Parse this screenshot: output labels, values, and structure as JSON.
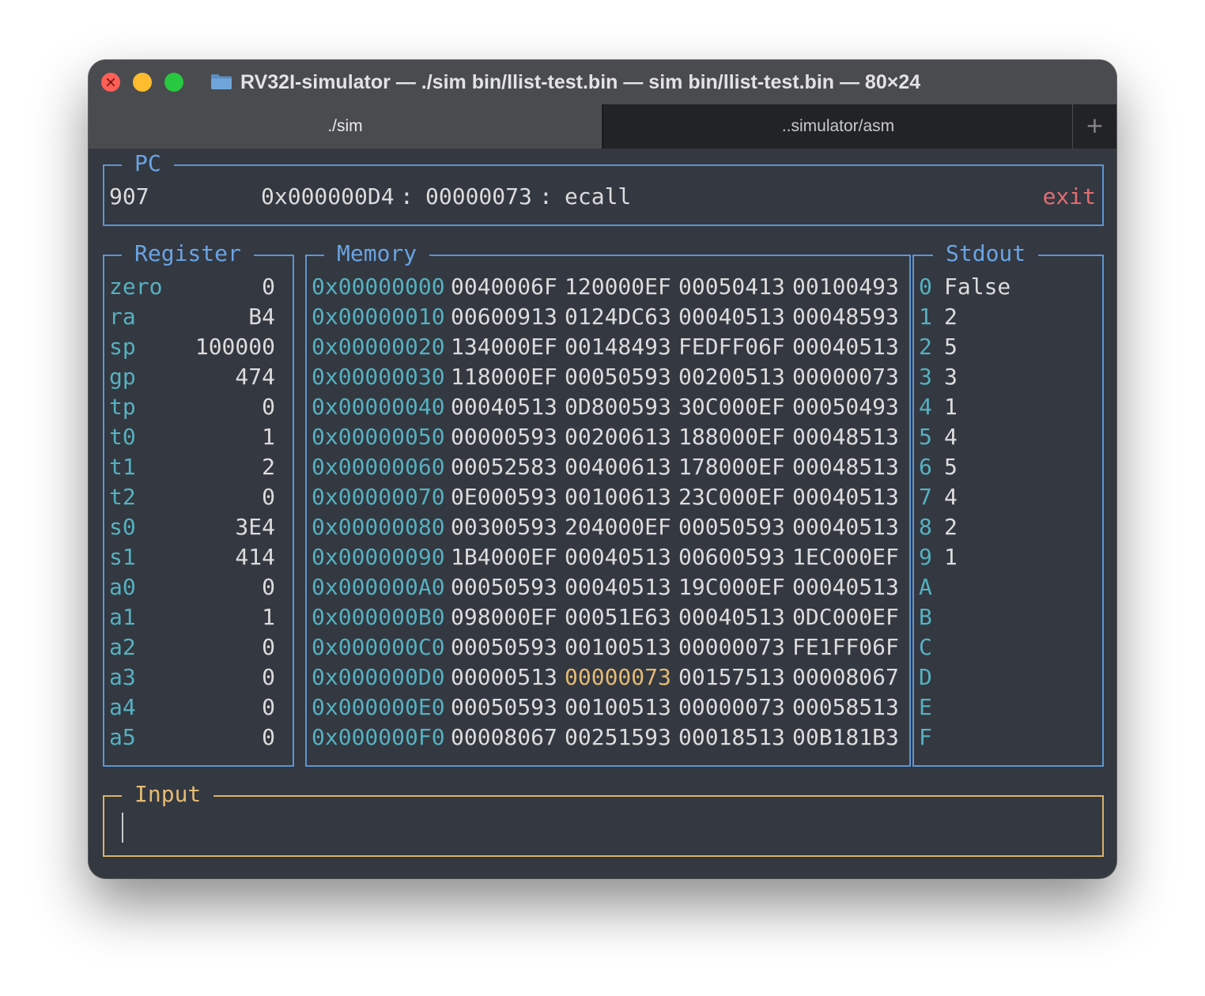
{
  "window": {
    "title": "RV32I-simulator — ./sim bin/llist-test.bin — sim bin/llist-test.bin — 80×24",
    "folder_icon": "folder-icon",
    "buttons": {
      "close": "close-icon",
      "minimize": "minimize-icon",
      "zoom": "zoom-icon"
    }
  },
  "tabs": [
    {
      "label": "./sim",
      "active": true
    },
    {
      "label": "..simulator/asm",
      "active": false
    }
  ],
  "new_tab_symbol": "+",
  "pc_panel": {
    "title": "PC",
    "count": "907",
    "address": "0x000000D4",
    "sep1": ":",
    "instruction_hex": "00000073",
    "sep2": ":",
    "mnemonic": "ecall",
    "status": "exit"
  },
  "register_panel": {
    "title": "Register",
    "registers": [
      {
        "name": "zero",
        "value": "0"
      },
      {
        "name": "ra",
        "value": "B4"
      },
      {
        "name": "sp",
        "value": "100000"
      },
      {
        "name": "gp",
        "value": "474"
      },
      {
        "name": "tp",
        "value": "0"
      },
      {
        "name": "t0",
        "value": "1"
      },
      {
        "name": "t1",
        "value": "2"
      },
      {
        "name": "t2",
        "value": "0"
      },
      {
        "name": "s0",
        "value": "3E4"
      },
      {
        "name": "s1",
        "value": "414"
      },
      {
        "name": "a0",
        "value": "0"
      },
      {
        "name": "a1",
        "value": "1"
      },
      {
        "name": "a2",
        "value": "0"
      },
      {
        "name": "a3",
        "value": "0"
      },
      {
        "name": "a4",
        "value": "0"
      },
      {
        "name": "a5",
        "value": "0"
      }
    ]
  },
  "memory_panel": {
    "title": "Memory",
    "highlight": {
      "row": 13,
      "col": 1
    },
    "rows": [
      {
        "address": "0x00000000",
        "words": [
          "0040006F",
          "120000EF",
          "00050413",
          "00100493"
        ]
      },
      {
        "address": "0x00000010",
        "words": [
          "00600913",
          "0124DC63",
          "00040513",
          "00048593"
        ]
      },
      {
        "address": "0x00000020",
        "words": [
          "134000EF",
          "00148493",
          "FEDFF06F",
          "00040513"
        ]
      },
      {
        "address": "0x00000030",
        "words": [
          "118000EF",
          "00050593",
          "00200513",
          "00000073"
        ]
      },
      {
        "address": "0x00000040",
        "words": [
          "00040513",
          "0D800593",
          "30C000EF",
          "00050493"
        ]
      },
      {
        "address": "0x00000050",
        "words": [
          "00000593",
          "00200613",
          "188000EF",
          "00048513"
        ]
      },
      {
        "address": "0x00000060",
        "words": [
          "00052583",
          "00400613",
          "178000EF",
          "00048513"
        ]
      },
      {
        "address": "0x00000070",
        "words": [
          "0E000593",
          "00100613",
          "23C000EF",
          "00040513"
        ]
      },
      {
        "address": "0x00000080",
        "words": [
          "00300593",
          "204000EF",
          "00050593",
          "00040513"
        ]
      },
      {
        "address": "0x00000090",
        "words": [
          "1B4000EF",
          "00040513",
          "00600593",
          "1EC000EF"
        ]
      },
      {
        "address": "0x000000A0",
        "words": [
          "00050593",
          "00040513",
          "19C000EF",
          "00040513"
        ]
      },
      {
        "address": "0x000000B0",
        "words": [
          "098000EF",
          "00051E63",
          "00040513",
          "0DC000EF"
        ]
      },
      {
        "address": "0x000000C0",
        "words": [
          "00050593",
          "00100513",
          "00000073",
          "FE1FF06F"
        ]
      },
      {
        "address": "0x000000D0",
        "words": [
          "00000513",
          "00000073",
          "00157513",
          "00008067"
        ]
      },
      {
        "address": "0x000000E0",
        "words": [
          "00050593",
          "00100513",
          "00000073",
          "00058513"
        ]
      },
      {
        "address": "0x000000F0",
        "words": [
          "00008067",
          "00251593",
          "00018513",
          "00B181B3"
        ]
      }
    ]
  },
  "stdout_panel": {
    "title": "Stdout",
    "lines": [
      {
        "index": "0",
        "text": "False"
      },
      {
        "index": "1",
        "text": "2"
      },
      {
        "index": "2",
        "text": "5"
      },
      {
        "index": "3",
        "text": "3"
      },
      {
        "index": "4",
        "text": "1"
      },
      {
        "index": "5",
        "text": "4"
      },
      {
        "index": "6",
        "text": "5"
      },
      {
        "index": "7",
        "text": "4"
      },
      {
        "index": "8",
        "text": "2"
      },
      {
        "index": "9",
        "text": "1"
      },
      {
        "index": "A",
        "text": ""
      },
      {
        "index": "B",
        "text": ""
      },
      {
        "index": "C",
        "text": ""
      },
      {
        "index": "D",
        "text": ""
      },
      {
        "index": "E",
        "text": ""
      },
      {
        "index": "F",
        "text": ""
      }
    ]
  },
  "input_panel": {
    "title": "Input",
    "value": ""
  },
  "colors": {
    "panel_border": "#5e95d1",
    "panel_title": "#6aa4e3",
    "input_border": "#d8b36b",
    "input_title": "#e5bb72",
    "address": "#56b1c0",
    "highlight_word": "#e5bb72",
    "exit_status": "#e46d70",
    "text": "#dcdcdc",
    "background": "#333841"
  }
}
